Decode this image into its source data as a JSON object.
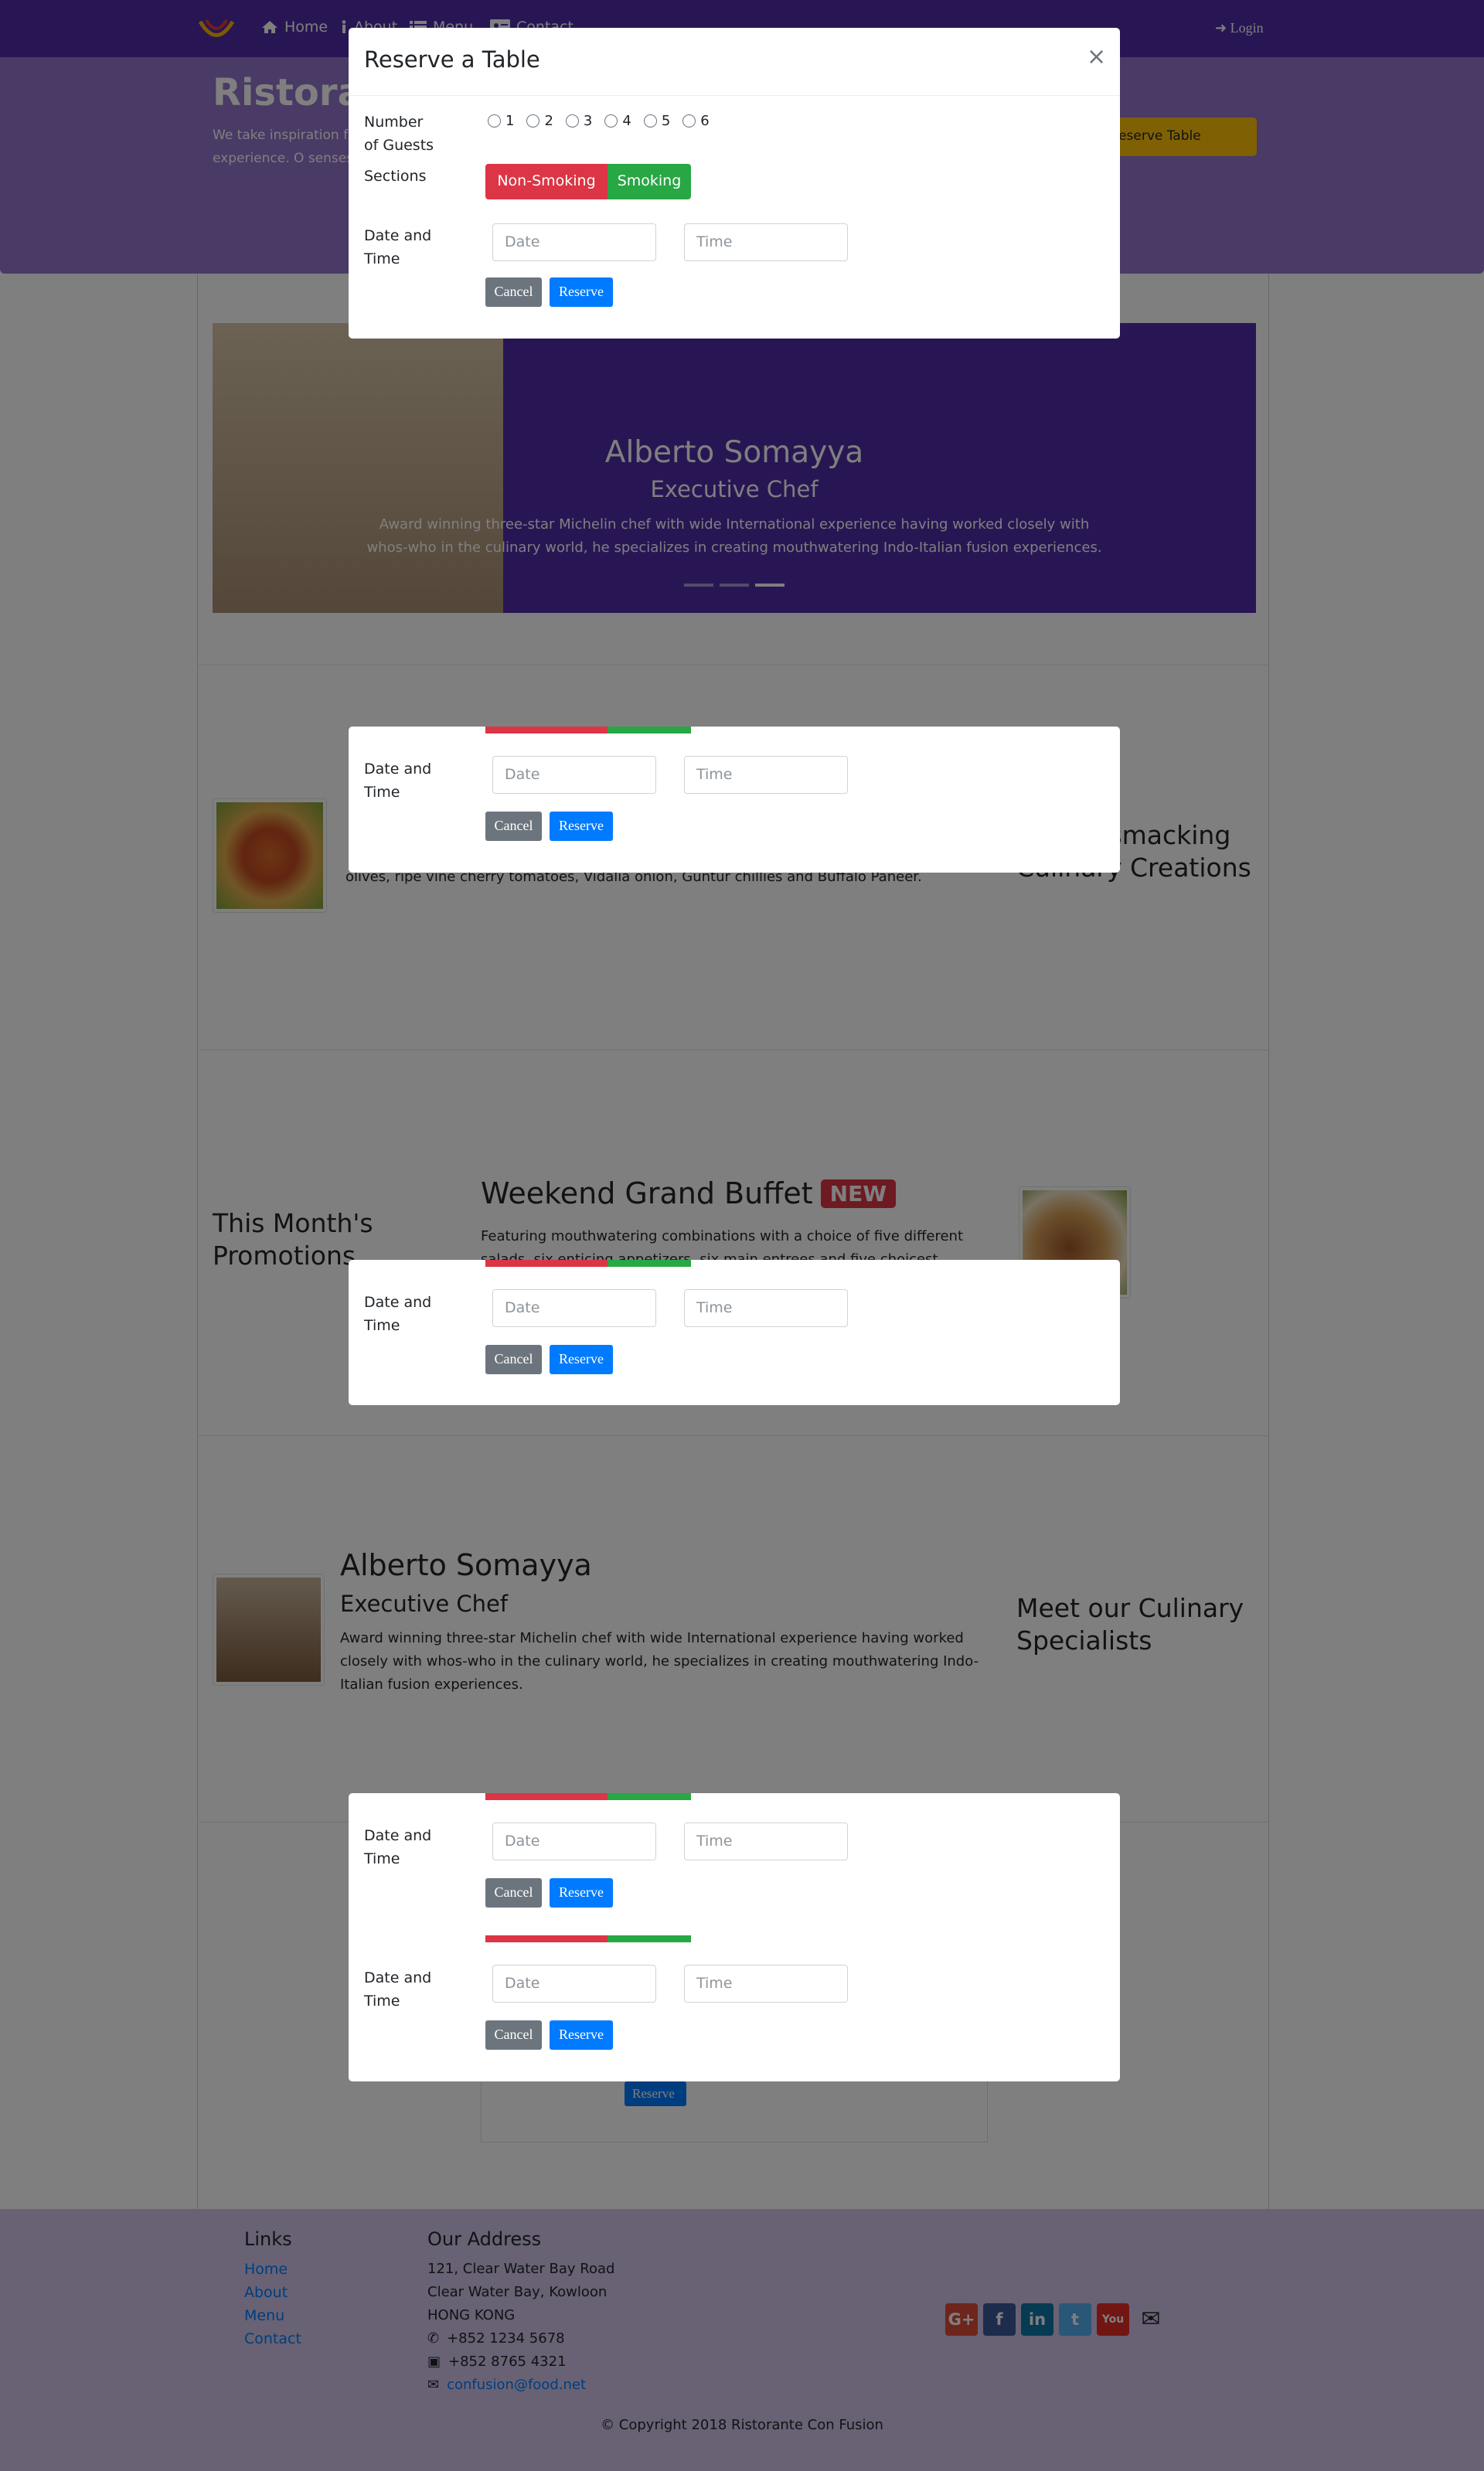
{
  "nav": {
    "items": [
      "Home",
      "About",
      "Menu",
      "Contact"
    ],
    "login": "Login"
  },
  "jumbotron": {
    "title": "Ristorante",
    "text": "We take inspiration fusion experience. O senses!",
    "reserve_button": "Reserve Table"
  },
  "carousel": {
    "name": "Alberto Somayya",
    "role": "Executive Chef",
    "description": "Award winning three-star Michelin chef with wide International experience having worked closely with whos-who in the culinary world, he specializes in creating mouthwatering Indo-Italian fusion experiences."
  },
  "dish": {
    "description": "olives, ripe vine cherry tomatoes, Vidalia onion, Guntur chillies and Buffalo Paneer."
  },
  "featured_heading": "Our Lipsmacking Culinary Creations",
  "promotion": {
    "heading": "This Month's Promotions",
    "title": "Weekend Grand Buffet",
    "badge": "NEW",
    "description": "Featuring mouthwatering combinations with a choice of five different salads, six enticing appetizers, six main entrees and five choicest desserts."
  },
  "leader": {
    "name": "Alberto Somayya",
    "role": "Executive Chef",
    "description": "Award winning three-star Michelin chef with wide International experience having worked closely with whos-who in the culinary world, he specializes in creating mouthwatering Indo-Italian fusion experiences.",
    "heading": "Meet our Culinary Specialists"
  },
  "background_reserve_button": "Reserve",
  "footer": {
    "links_heading": "Links",
    "links": [
      "Home",
      "About",
      "Menu",
      "Contact"
    ],
    "address_heading": "Our Address",
    "address": [
      "121, Clear Water Bay Road",
      "Clear Water Bay, Kowloon",
      "HONG KONG"
    ],
    "phone": "+852 1234 5678",
    "fax": "+852 8765 4321",
    "email": "confusion@food.net",
    "social_icons": [
      "google-plus-icon",
      "facebook-icon",
      "linkedin-icon",
      "twitter-icon",
      "youtube-icon",
      "envelope-icon"
    ],
    "copyright": "© Copyright 2018 Ristorante Con Fusion"
  },
  "modal": {
    "title": "Reserve a Table",
    "close": "×",
    "guests_label": "Number of Guests",
    "guest_options": [
      "1",
      "2",
      "3",
      "4",
      "5",
      "6"
    ],
    "sections_label": "Sections",
    "non_smoking": "Non-Smoking",
    "smoking": "Smoking",
    "datetime_label": "Date and Time",
    "date_placeholder": "Date",
    "time_placeholder": "Time",
    "cancel": "Cancel",
    "reserve": "Reserve"
  },
  "colors": {
    "primary": "#512da8",
    "jumbotron": "#9575cd",
    "footer": "#d1c4e9",
    "danger": "#dc3545",
    "success": "#28a745",
    "button_primary": "#007bff",
    "warning": "#ffc107"
  }
}
